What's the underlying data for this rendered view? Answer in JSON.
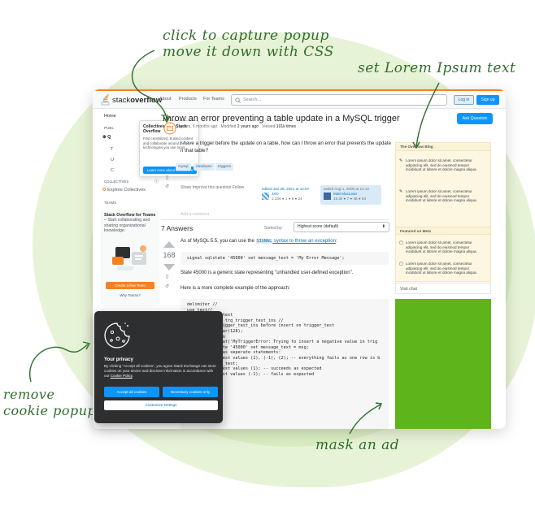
{
  "annotations": {
    "capture_popup_line1": "click to capture popup",
    "capture_popup_line2": "move it down with CSS",
    "lorem_text": "set Lorem Ipsum text",
    "cookie_line1": "remove",
    "cookie_line2": "cookie popup",
    "mask_ad": "mask an ad"
  },
  "topbar": {
    "logo_light": "stack",
    "logo_bold": "overflow",
    "nav": [
      "About",
      "Products",
      "For Teams"
    ],
    "search_placeholder": "Search...",
    "login": "Log in",
    "signup": "Sign up"
  },
  "left_nav": {
    "home": "Home",
    "public": "PUBL",
    "q_item": "Q",
    "t_item": "T",
    "u_item": "U",
    "c_item": "C",
    "collectives": "COLLECTIVES",
    "explore_collectives": "Explore Collectives",
    "teams": "TEAMS",
    "teams_title": "Stack Overflow for Teams",
    "teams_dash": " – Start collaborating and sharing organizational knowledge.",
    "create_team": "Create a free Team",
    "why_teams": "Why Teams?"
  },
  "popover": {
    "title": "Collectives™ on Stack Overflow",
    "desc": "Find centralized, trusted content and collaborate around the technologies you use most.",
    "button": "Learn more about Collectives"
  },
  "question": {
    "title": "Throw an error preventing a table update in a MySQL trigger",
    "ask_button": "Ask Question",
    "asked": "years, 6 months ago",
    "modified_label": "Modified",
    "modified": "2 years ago",
    "viewed_label": "Viewed",
    "viewed": "101k times",
    "body_line1": "I have a trigger before the update on a table, how can I throw an error that prevents the update",
    "body_line2": "n that table?",
    "tags": [
      "mysql",
      "database",
      "triggers"
    ],
    "actions": "Share  Improve this question  Follow",
    "editor_label": "edited Jan 29, 2021 at 12:57",
    "editor_name": "JXD",
    "editor_rep": "1,339 ● 1 ● 5 ● 24",
    "asker_label": "asked Aug 1, 2008 at 12:12",
    "asker_name": "Matt MacLean",
    "asker_rep": "19.3k ● 7 ● 48 ● 53",
    "add_comment": "Add a comment"
  },
  "answers": {
    "count": "7 Answers",
    "sorted_by": "Sorted by:",
    "sort_value": "Highest score (default)",
    "score": "168",
    "line1_pre": "As of MySQL 5.5, you can use the ",
    "line1_code": "SIGNAL",
    "line1_link": " syntax to throw an exception",
    "line1_post": ":",
    "code1": "signal sqlstate '45000' set message_text = 'My Error Message';",
    "line2": "State 45000 is a generic state representing \"unhandled user-defined exception\".",
    "line3": "Here is a more complete example of the approach:",
    "code_lines": [
      "delimiter //",
      "use test//",
      "            r_test",
      "",
      "",
      "",
      "            ts trg_trigger_test_ins //",
      "            trigger_test_ins before insert on trigger_test",
      "",
      "",
      "            char(128);",
      "            hen",
      "            ncat('MyTriggerError: Trying to insert a negative value in trig",
      "            tate '45000' set message_text = msg;",
      "",
      "",
      "",
      "",
      "",
      "",
      "            g as seperate statements:",
      "            _test values (1), (-1), (2); -- everything fails as one row is b",
      "            er_test;",
      "            _test values (1); -- succeeds as expected",
      "            test values (-1); -- fails as expected"
    ]
  },
  "sidebar": {
    "blog_title": "The Overflow Blog",
    "blog_items": [
      "Lorem ipsum dolor sit amet, consectetur adipiscing elit, sed do eiusmod tempor incididunt ut labore et dolore magna aliqua.",
      "Lorem ipsum dolor sit amet, consectetur adipiscing elit, sed do eiusmod tempor incididunt ut labore et dolore magna aliqua."
    ],
    "meta_title": "Featured on Meta",
    "meta_items": [
      "Lorem ipsum dolor sit amet, consectetur adipiscing elit, sed do eiusmod tempor incididunt ut labore et dolore magna aliqua.",
      "Lorem ipsum dolor sit amet, consectetur adipiscing elit, sed do eiusmod tempor incididunt ut labore et dolore magna aliqua."
    ],
    "visit_chat": "Visit chat",
    "ad_color": "#5eb51b"
  },
  "cookie": {
    "title": "Your privacy",
    "desc_pre": "By clicking \"Accept all cookies\", you agree Stack Exchange can store cookies on your device and disclose information in accordance with our ",
    "desc_link": "Cookie Policy",
    "desc_post": ".",
    "accept": "Accept all cookies",
    "necessary": "Necessary cookies only",
    "customize": "Customize settings"
  },
  "colors": {
    "accent_orange": "#f48225",
    "brand_blue": "#0a95ff",
    "annotation_green": "#2f6d2c"
  }
}
